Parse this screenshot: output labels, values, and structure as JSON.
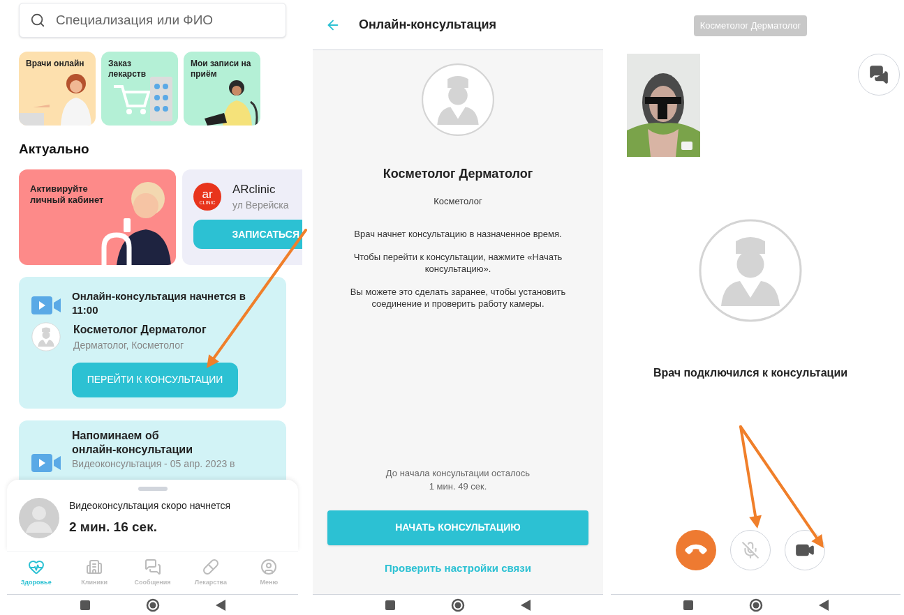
{
  "home": {
    "search": {
      "placeholder": "Специализация или ФИО"
    },
    "tiles": [
      {
        "label": "Врачи онлайн",
        "color": "#fde0ae"
      },
      {
        "label": "Заказ лекарств",
        "color": "#b4f0d6"
      },
      {
        "label": "Мои записи на приём",
        "color": "#b4f0d6"
      }
    ],
    "section_title": "Актуально",
    "promos": [
      {
        "kind": "banner",
        "title": "Активируйте личный кабинет"
      },
      {
        "kind": "clinic",
        "logo_text": "ar",
        "logo_caption": "CLINIC",
        "name": "ARclinic",
        "address": "ул Верейска",
        "button": "ЗАПИСАТЬСЯ"
      }
    ],
    "appointment": {
      "title": "Онлайн-консультация начнется в 11:00",
      "doctor": "Косметолог Дерматолог",
      "specialties": "Дерматолог, Косметолог",
      "button": "ПЕРЕЙТИ К КОНСУЛЬТАЦИИ"
    },
    "reminder": {
      "title": "Напоминаем об онлайн-консультации",
      "subtitle": "Видеоконсультация - 05 апр. 2023 в"
    },
    "sheet": {
      "title": "Видеоконсультация скоро начнется",
      "countdown": "2 мин. 16 сек."
    },
    "nav": [
      {
        "label": "Здоровье",
        "selected": true
      },
      {
        "label": "Клиники",
        "selected": false
      },
      {
        "label": "Сообщения",
        "selected": false
      },
      {
        "label": "Лекарства",
        "selected": false
      },
      {
        "label": "Меню",
        "selected": false
      }
    ]
  },
  "consultation": {
    "title": "Онлайн-консультация",
    "doctor": "Косметолог Дерматолог",
    "specialty": "Косметолог",
    "paragraphs": [
      "Врач начнет консультацию в назначенное время.",
      "Чтобы перейти к консультации, нажмите «Начать консультацию».",
      "Вы можете это сделать заранее, чтобы установить соединение и проверить работу камеры."
    ],
    "countdown_label": "До начала консультации осталось",
    "countdown": "1 мин. 49 сек.",
    "start_button": "НАЧАТЬ КОНСУЛЬТАЦИЮ",
    "check_link": "Проверить настройки связи"
  },
  "call": {
    "doctor_badge": "Косметолог Дерматолог",
    "status": "Врач подключился к консультации",
    "controls": [
      {
        "kind": "hangup"
      },
      {
        "kind": "mic",
        "on": false
      },
      {
        "kind": "camera",
        "on": true
      }
    ]
  }
}
